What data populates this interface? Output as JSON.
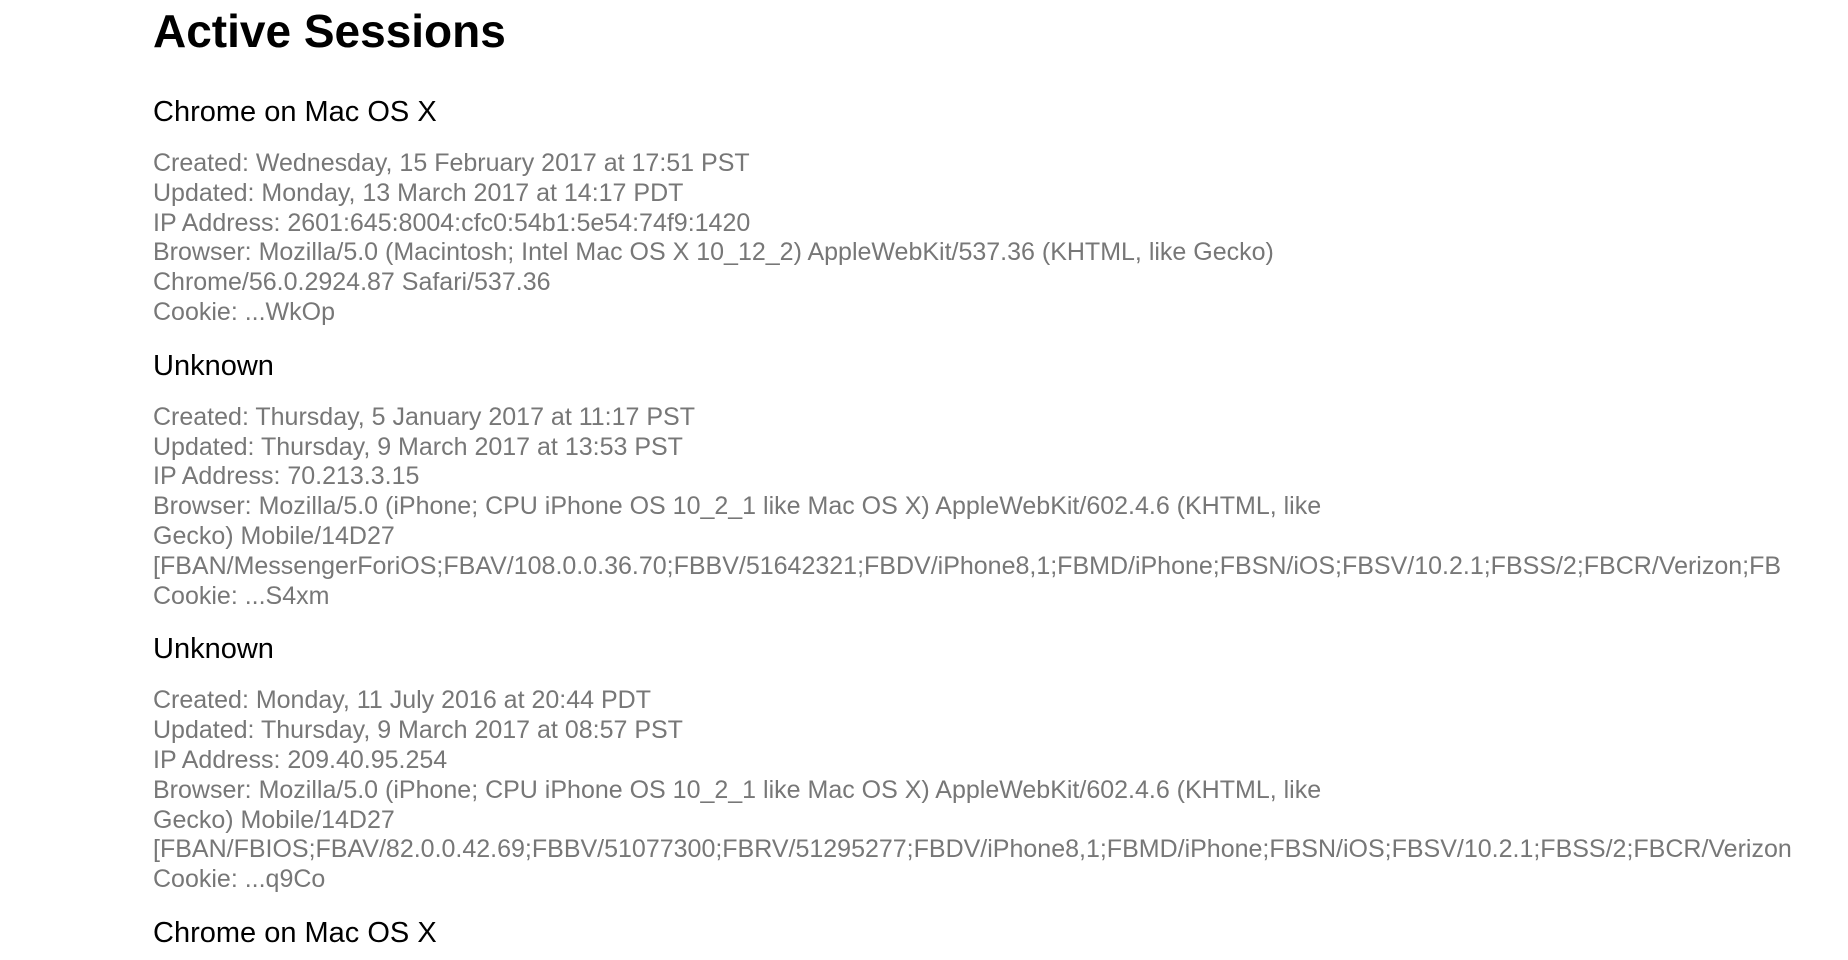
{
  "page": {
    "title": "Active Sessions"
  },
  "sessions": [
    {
      "name": "Chrome on Mac OS X",
      "lines": [
        "Created: Wednesday, 15 February 2017 at 17:51 PST",
        "Updated: Monday, 13 March 2017 at 14:17 PDT",
        "IP Address: 2601:645:8004:cfc0:54b1:5e54:74f9:1420",
        "Browser: Mozilla/5.0 (Macintosh; Intel Mac OS X 10_12_2) AppleWebKit/537.36 (KHTML, like Gecko)",
        "Chrome/56.0.2924.87 Safari/537.36",
        "Cookie: ...WkOp"
      ]
    },
    {
      "name": "Unknown",
      "lines": [
        "Created: Thursday, 5 January 2017 at 11:17 PST",
        "Updated: Thursday, 9 March 2017 at 13:53 PST",
        "IP Address: 70.213.3.15",
        "Browser: Mozilla/5.0 (iPhone; CPU iPhone OS 10_2_1 like Mac OS X) AppleWebKit/602.4.6 (KHTML, like",
        "Gecko) Mobile/14D27",
        "[FBAN/MessengerForiOS;FBAV/108.0.0.36.70;FBBV/51642321;FBDV/iPhone8,1;FBMD/iPhone;FBSN/iOS;FBSV/10.2.1;FBSS/2;FBCR/Verizon;FB",
        "Cookie: ...S4xm"
      ]
    },
    {
      "name": "Unknown",
      "lines": [
        "Created: Monday, 11 July 2016 at 20:44 PDT",
        "Updated: Thursday, 9 March 2017 at 08:57 PST",
        "IP Address: 209.40.95.254",
        "Browser: Mozilla/5.0 (iPhone; CPU iPhone OS 10_2_1 like Mac OS X) AppleWebKit/602.4.6 (KHTML, like",
        "Gecko) Mobile/14D27",
        "[FBAN/FBIOS;FBAV/82.0.0.42.69;FBBV/51077300;FBRV/51295277;FBDV/iPhone8,1;FBMD/iPhone;FBSN/iOS;FBSV/10.2.1;FBSS/2;FBCR/Verizon",
        "Cookie: ...q9Co"
      ]
    },
    {
      "name": "Chrome on Mac OS X",
      "lines": []
    }
  ]
}
